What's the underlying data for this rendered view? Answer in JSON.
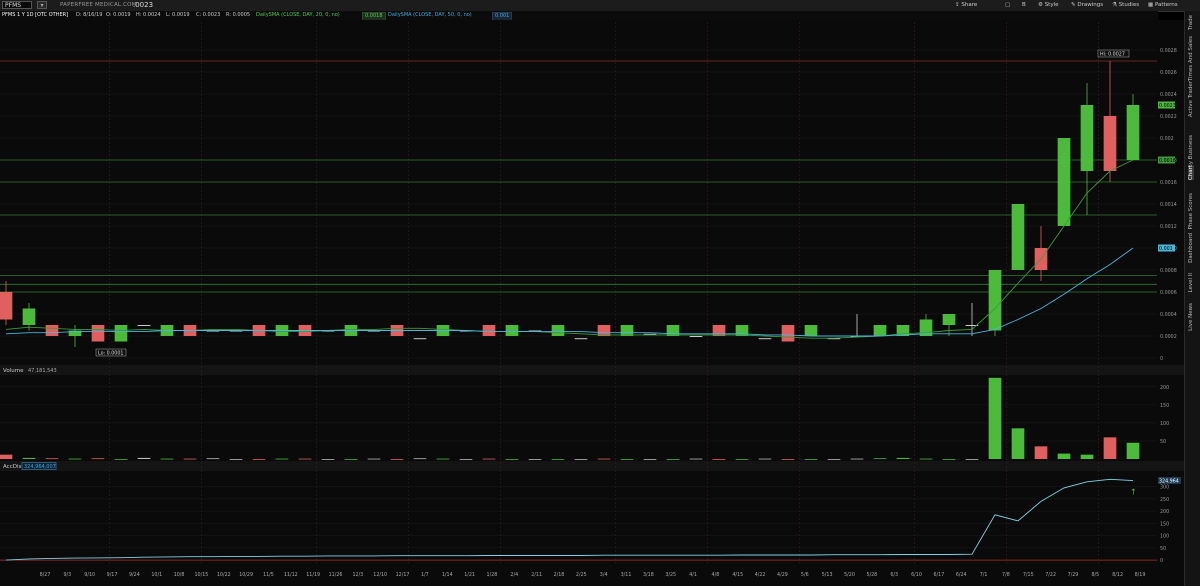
{
  "header": {
    "symbol": "PFMS",
    "company": "PAPERFREE MEDICAL.COM",
    "last_price": ".0023",
    "buttons": [
      "Share",
      "B",
      "Style",
      "Drawings",
      "Studies",
      "Patterns"
    ]
  },
  "study_bar": {
    "title": "PFMS 1 Y 1D [OTC OTHER]",
    "date": "D: 8/16/19",
    "open": "O: 0.0019",
    "high": "H: 0.0024",
    "low": "L: 0.0019",
    "close": "C: 0.0023",
    "range": "R: 0.0005",
    "sma20_label": "DailySMA (CLOSE, DAY, 20, 0, no)",
    "sma20_value": "0.0018",
    "sma50_label": "DailySMA (CLOSE, DAY, 50, 0, no)",
    "sma50_value": "0.001"
  },
  "side_tabs": [
    "Trade",
    "Times And Sales",
    "Active Trader",
    "By Business",
    "Chart",
    "Phase Scores",
    "Dashboard",
    "Level II",
    "Live News"
  ],
  "colors": {
    "up": "#4cbb3c",
    "down": "#e0605f",
    "sma20": "#3d9a3d",
    "sma50": "#49b6dc",
    "hline_green": "#2f7a2f",
    "hline_red": "#8b2a2a"
  },
  "chart_data": [
    {
      "type": "candlestick",
      "title": "PFMS 1 Y 1D [OTC OTHER]",
      "ylabel": "",
      "ylim": [
        0,
        0.003
      ],
      "y_ticks": [
        "0",
        "0.0002",
        "0.0004",
        "0.0006",
        "0.0008",
        "0.0010",
        "0.0012",
        "0.0014",
        "0.0016",
        "0.0018",
        "0.002",
        "0.0022",
        "0.0024",
        "0.0026",
        "0.0028"
      ],
      "x_ticks": [
        "8/27",
        "9/3",
        "9/10",
        "9/17",
        "9/24",
        "10/1",
        "10/8",
        "10/15",
        "10/22",
        "10/29",
        "11/5",
        "11/12",
        "11/19",
        "11/26",
        "12/3",
        "12/10",
        "12/17",
        "1/7",
        "1/14",
        "1/21",
        "1/28",
        "2/4",
        "2/11",
        "2/18",
        "2/25",
        "3/4",
        "3/11",
        "3/18",
        "3/25",
        "4/1",
        "4/8",
        "4/15",
        "4/22",
        "4/29",
        "5/6",
        "5/13",
        "5/20",
        "5/28",
        "6/3",
        "6/10",
        "6/17",
        "6/24",
        "7/1",
        "7/8",
        "7/15",
        "7/22",
        "7/29",
        "8/5",
        "8/12",
        "8/19"
      ],
      "annotations": {
        "hi": "Hi: 0.0027",
        "lo": "Lo: 0.0001",
        "price_tag": "0.0023",
        "sma20_tag": "0.0018",
        "sma50_tag": "0.001"
      },
      "horizontal_lines": [
        0.0027,
        0.0018,
        0.0016,
        0.0013,
        0.00075,
        0.00067,
        0.0006
      ],
      "series": [
        {
          "name": "DailySMA (CLOSE, DAY, 20, 0, no)",
          "values": [
            0.00026,
            0.00028,
            0.00027,
            0.00026,
            0.00026,
            0.00025,
            0.00026,
            0.00025,
            0.00025,
            0.00026,
            0.00026,
            0.00025,
            0.00024,
            0.00024,
            0.00025,
            0.00026,
            0.00026,
            0.00027,
            0.00027,
            0.00026,
            0.00025,
            0.00024,
            0.00024,
            0.00024,
            0.00023,
            0.00022,
            0.00021,
            0.00021,
            0.00021,
            0.00021,
            0.00021,
            0.00021,
            0.00021,
            0.0002,
            0.00019,
            0.00018,
            0.00018,
            0.00019,
            0.0002,
            0.00022,
            0.00023,
            0.00025,
            0.00026,
            0.00045,
            0.00068,
            0.0009,
            0.0012,
            0.0015,
            0.0017,
            0.0018
          ]
        },
        {
          "name": "DailySMA (CLOSE, DAY, 50, 0, no)",
          "values": [
            0.00022,
            0.00023,
            0.00023,
            0.00024,
            0.00024,
            0.00024,
            0.00024,
            0.00025,
            0.00025,
            0.00025,
            0.00025,
            0.00025,
            0.00025,
            0.00025,
            0.00025,
            0.00025,
            0.00025,
            0.00025,
            0.00025,
            0.00025,
            0.00025,
            0.00024,
            0.00024,
            0.00024,
            0.00024,
            0.00024,
            0.00023,
            0.00023,
            0.00023,
            0.00022,
            0.00022,
            0.00022,
            0.00022,
            0.00021,
            0.00021,
            0.0002,
            0.0002,
            0.0002,
            0.0002,
            0.00021,
            0.00022,
            0.00022,
            0.00022,
            0.00026,
            0.00035,
            0.00045,
            0.00058,
            0.00072,
            0.00085,
            0.001
          ]
        }
      ],
      "candles": [
        [
          0.0006,
          0.0007,
          0.0003,
          0.00035
        ],
        [
          0.0003,
          0.0005,
          0.00025,
          0.00045
        ],
        [
          0.0003,
          0.0003,
          0.0002,
          0.0002
        ],
        [
          0.0002,
          0.0003,
          0.0001,
          0.00025
        ],
        [
          0.0003,
          0.0003,
          0.00015,
          0.00015
        ],
        [
          0.00015,
          0.0003,
          0.00015,
          0.0003
        ],
        [
          0.0003,
          0.0003,
          0.0003,
          0.0003
        ],
        [
          0.0002,
          0.0003,
          0.0002,
          0.0003
        ],
        [
          0.0003,
          0.0003,
          0.0002,
          0.0002
        ],
        [
          0.00025,
          0.00025,
          0.00025,
          0.00025
        ],
        [
          0.00025,
          0.00025,
          0.00025,
          0.00025
        ],
        [
          0.0003,
          0.0003,
          0.0002,
          0.0002
        ],
        [
          0.0002,
          0.0003,
          0.0002,
          0.0003
        ],
        [
          0.0003,
          0.0003,
          0.0002,
          0.0002
        ],
        [
          0.00025,
          0.00025,
          0.00025,
          0.00025
        ],
        [
          0.0002,
          0.0003,
          0.0002,
          0.0003
        ],
        [
          0.00025,
          0.00025,
          0.00025,
          0.00025
        ],
        [
          0.0003,
          0.0003,
          0.0002,
          0.0002
        ],
        [
          0.00018,
          0.00018,
          0.00018,
          0.00018
        ],
        [
          0.0002,
          0.0003,
          0.0002,
          0.0003
        ],
        [
          0.00025,
          0.00025,
          0.00025,
          0.00025
        ],
        [
          0.0003,
          0.0003,
          0.0002,
          0.0002
        ],
        [
          0.0002,
          0.0003,
          0.0002,
          0.0003
        ],
        [
          0.00025,
          0.00025,
          0.00025,
          0.00025
        ],
        [
          0.0002,
          0.0003,
          0.0002,
          0.0003
        ],
        [
          0.00018,
          0.00018,
          0.00018,
          0.00018
        ],
        [
          0.0003,
          0.0003,
          0.0002,
          0.0002
        ],
        [
          0.0002,
          0.0003,
          0.0002,
          0.0003
        ],
        [
          0.00022,
          0.00022,
          0.00022,
          0.00022
        ],
        [
          0.0002,
          0.0003,
          0.0002,
          0.0003
        ],
        [
          0.0002,
          0.0002,
          0.0002,
          0.0002
        ],
        [
          0.0003,
          0.0003,
          0.0002,
          0.0002
        ],
        [
          0.0002,
          0.0003,
          0.0002,
          0.0003
        ],
        [
          0.00018,
          0.00018,
          0.00018,
          0.00018
        ],
        [
          0.0003,
          0.0003,
          0.00015,
          0.00015
        ],
        [
          0.0002,
          0.0003,
          0.0002,
          0.0003
        ],
        [
          0.00018,
          0.00018,
          0.00018,
          0.00018
        ],
        [
          0.0002,
          0.0004,
          0.0002,
          0.0002
        ],
        [
          0.0002,
          0.0003,
          0.0002,
          0.0003
        ],
        [
          0.0002,
          0.0003,
          0.0002,
          0.0003
        ],
        [
          0.0002,
          0.0004,
          0.0002,
          0.00035
        ],
        [
          0.0003,
          0.0004,
          0.0002,
          0.0004
        ],
        [
          0.0003,
          0.0005,
          0.0002,
          0.0003
        ],
        [
          0.00025,
          0.0008,
          0.0002,
          0.0008
        ],
        [
          0.0008,
          0.0014,
          0.0008,
          0.0014
        ],
        [
          0.001,
          0.0012,
          0.0007,
          0.0008
        ],
        [
          0.0012,
          0.002,
          0.0012,
          0.002
        ],
        [
          0.0017,
          0.0025,
          0.0013,
          0.0023
        ],
        [
          0.0022,
          0.0027,
          0.0016,
          0.0017
        ],
        [
          0.0018,
          0.0024,
          0.0018,
          0.0023
        ]
      ]
    },
    {
      "type": "bar",
      "title": "Volume",
      "value_label": "47,181,543",
      "ylabel": "",
      "ylim": [
        0,
        230
      ],
      "y_ticks": [
        "50",
        "100",
        "150",
        "200"
      ],
      "values": [
        12,
        3,
        2,
        1,
        2,
        0,
        3,
        1,
        1,
        2,
        0,
        0,
        1,
        1,
        0,
        0,
        1,
        0,
        2,
        1,
        0,
        1,
        0,
        0,
        0,
        0,
        1,
        0,
        0,
        0,
        1,
        0,
        0,
        1,
        0,
        0,
        0,
        1,
        2,
        3,
        1,
        0,
        0,
        225,
        85,
        35,
        15,
        12,
        60,
        45
      ]
    },
    {
      "type": "line",
      "title": "AccDist",
      "value_label": "324,964,007",
      "ylabel": "",
      "ylim": [
        -20,
        360
      ],
      "y_ticks": [
        "0",
        "50",
        "100",
        "150",
        "200",
        "250",
        "300"
      ],
      "tag": "324.964",
      "values": [
        0,
        5,
        7,
        8,
        9,
        10,
        12,
        13,
        14,
        14,
        15,
        15,
        16,
        16,
        17,
        17,
        17,
        18,
        18,
        18,
        18,
        19,
        19,
        19,
        19,
        19,
        20,
        20,
        20,
        20,
        20,
        20,
        21,
        21,
        21,
        21,
        22,
        22,
        22,
        23,
        23,
        23,
        24,
        185,
        160,
        240,
        295,
        320,
        330,
        325
      ]
    }
  ]
}
